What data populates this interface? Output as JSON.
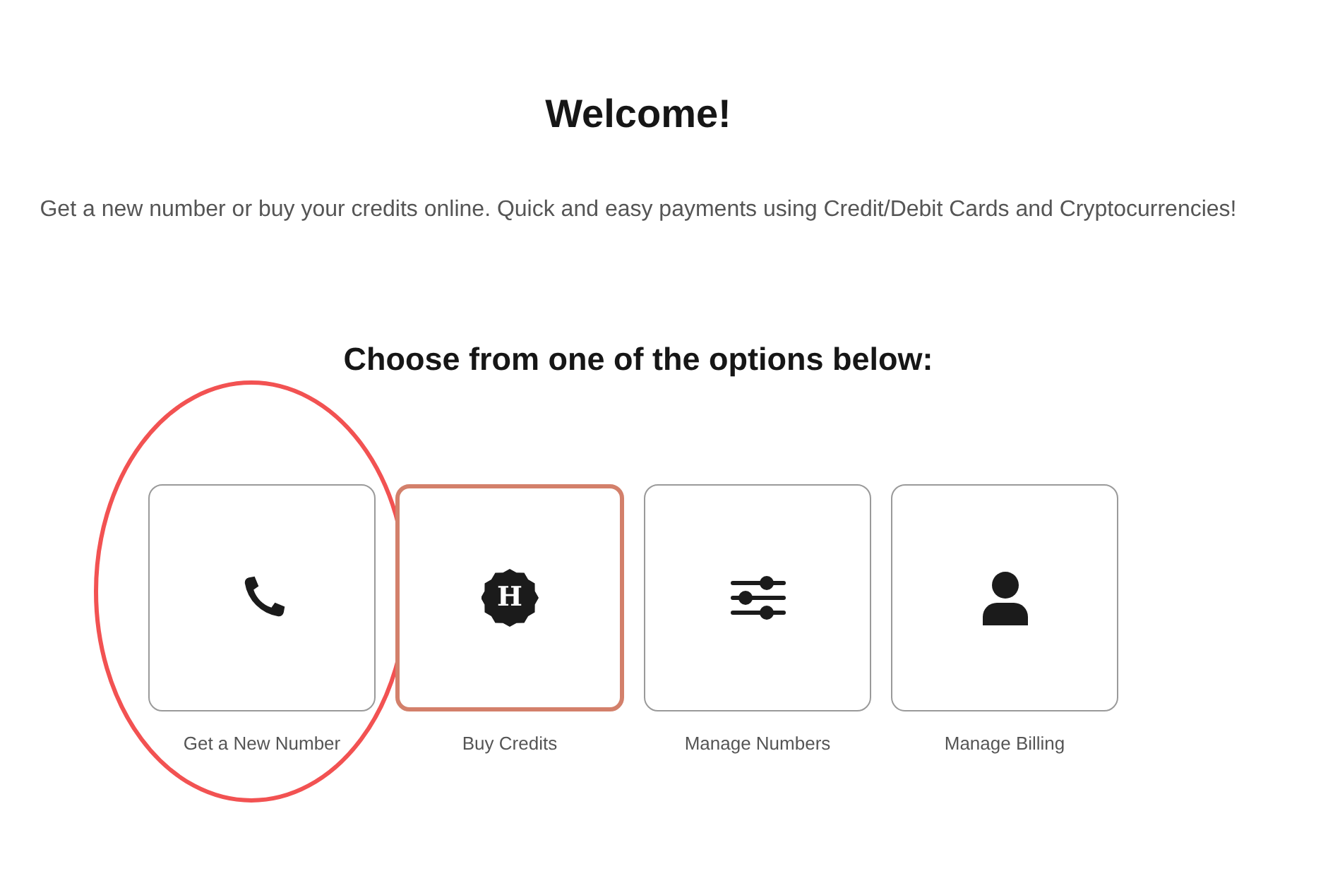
{
  "title": "Welcome!",
  "intro": "Get a new number or buy your credits online. Quick and easy payments using Credit/Debit Cards and Cryptocurrencies!",
  "options_heading": "Choose from one of the options below:",
  "options": [
    {
      "label": "Get a New Number",
      "selected": false,
      "circled": true
    },
    {
      "label": "Buy Credits",
      "selected": true,
      "circled": false,
      "logo_text": "H"
    },
    {
      "label": "Manage Numbers",
      "selected": false,
      "circled": false
    },
    {
      "label": "Manage Billing",
      "selected": false,
      "circled": false
    }
  ]
}
